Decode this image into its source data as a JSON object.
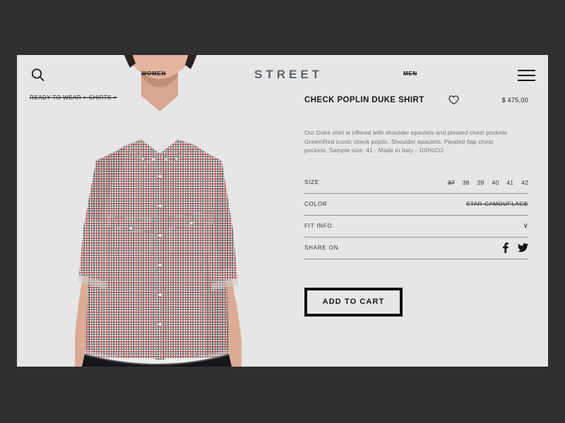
{
  "colors": {
    "page_background": "#303030",
    "card_background": "#e6e6e6",
    "logo": "#5d636b",
    "text": "#14171a",
    "muted_text": "#6c7176",
    "divider": "#8e9194",
    "shirt_red": "#c0404a",
    "shirt_green": "#2f5a52"
  },
  "header": {
    "search_icon": "search-icon",
    "nav_left": "WOMEN",
    "logo": "STREET",
    "nav_right": "MEN",
    "menu_icon": "hamburger-menu-icon"
  },
  "breadcrumb": "READY TO WEAR > SHIRTS >",
  "product": {
    "title": "CHECK POPLIN DUKE SHIRT",
    "wishlist_icon": "heart-icon",
    "price": "$ 475,00",
    "description": [
      "Our Duke shirt is offered with shoulder epaulets and pleated chest pockets",
      "Green\\Red iconic check poplin. Shoulder epaulets. Pleated flap chest",
      "pockets. Sample size: 41 - Made in Italy - 100%CO"
    ],
    "specs": {
      "size": {
        "label": "SIZE",
        "options": [
          {
            "value": "37",
            "sold_out": true
          },
          {
            "value": "38",
            "sold_out": false
          },
          {
            "value": "39",
            "sold_out": false
          },
          {
            "value": "40",
            "sold_out": false
          },
          {
            "value": "41",
            "sold_out": false
          },
          {
            "value": "42",
            "sold_out": false
          }
        ]
      },
      "color": {
        "label": "COLOR",
        "value": "STAR CAMOUFLAGE"
      },
      "fit_info": {
        "label": "FIT INFO",
        "chevron": "∨"
      },
      "share": {
        "label": "SHARE ON",
        "networks": [
          "facebook-icon",
          "twitter-icon"
        ]
      }
    },
    "add_to_cart": "ADD TO CART"
  }
}
